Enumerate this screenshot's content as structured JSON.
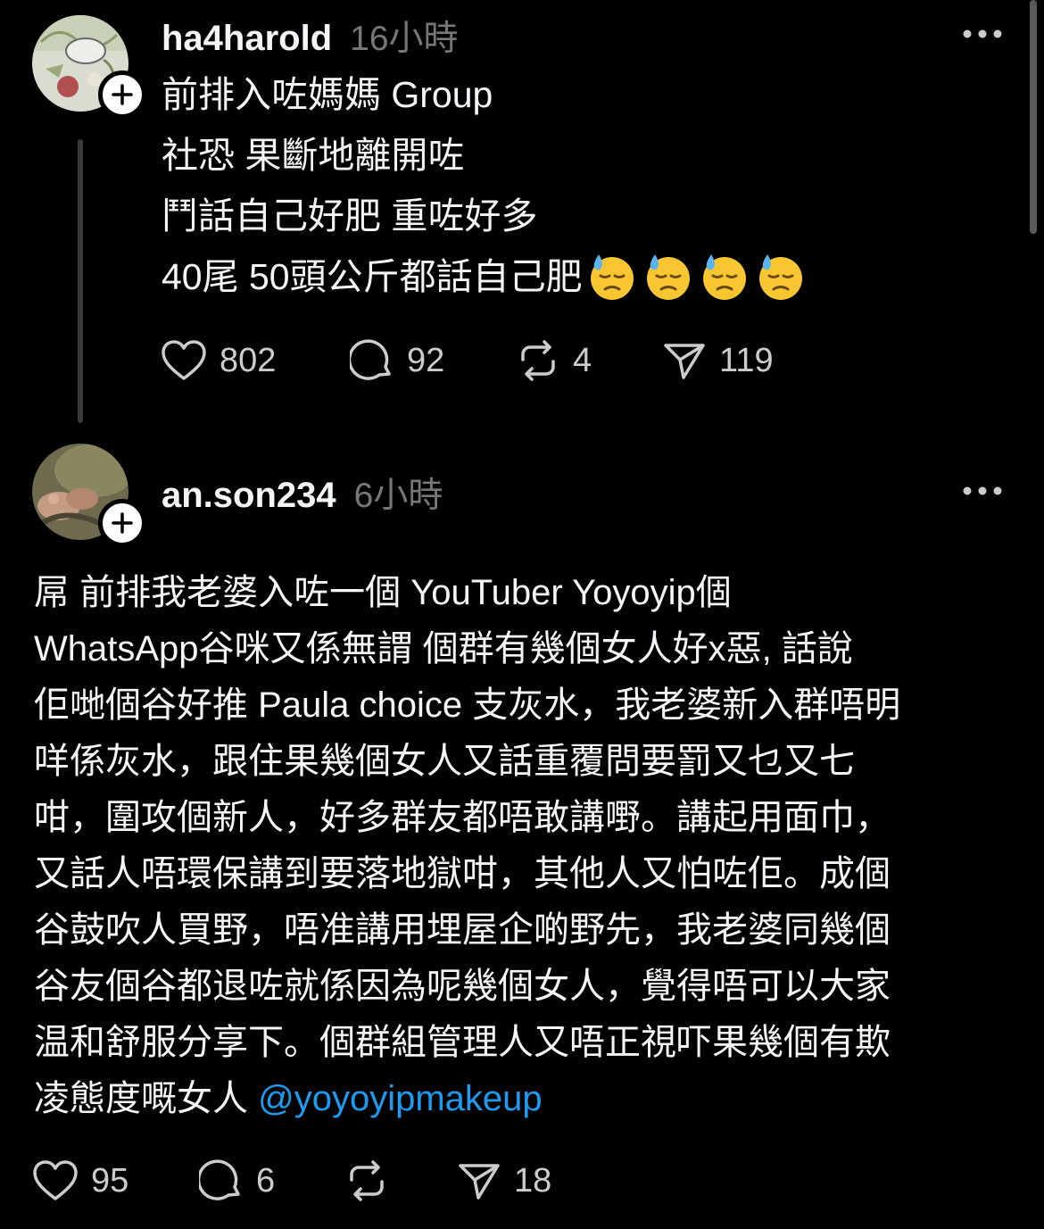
{
  "posts": [
    {
      "username": "ha4harold",
      "timestamp": "16小時",
      "lines": [
        "前排入咗媽媽 Group",
        "社恐 果斷地離開咗",
        "鬥話自己好肥 重咗好多",
        "40尾 50頭公斤都話自己肥"
      ],
      "emoji": "downcast-face-with-sweat",
      "emoji_count": 4,
      "likes": "802",
      "replies": "92",
      "reposts": "4",
      "shares": "119"
    },
    {
      "username": "an.son234",
      "timestamp": "6小時",
      "lines": [
        "屌 前排我老婆入咗一個 YouTuber Yoyoyip個",
        " WhatsApp谷咪又係無謂 個群有幾個女人好x惡, 話說",
        "佢哋個谷好推 Paula choice 支灰水，我老婆新入群唔明",
        "咩係灰水，跟住果幾個女人又話重覆問要罰又乜又七",
        "咁，圍攻個新人，好多群友都唔敢講嘢。講起用面巾，",
        "又話人唔環保講到要落地獄咁，其他人又怕咗佢。成個",
        "谷鼓吹人買野，唔准講用埋屋企啲野先，我老婆同幾個",
        "谷友個谷都退咗就係因為呢幾個女人，覺得唔可以大家",
        "温和舒服分享下。個群組管理人又唔正視吓果幾個有欺"
      ],
      "last_line": "凌態度嘅女人 ",
      "mention": "@yoyoyipmakeup",
      "likes": "95",
      "replies": "6",
      "reposts": "",
      "shares": "18"
    }
  ],
  "colors": {
    "background": "#000000",
    "text": "#f3f5f7",
    "secondary": "#777777",
    "mention": "#1d9bf0",
    "thread_line": "#3a3a3a"
  },
  "icons": [
    "heart-icon",
    "comment-icon",
    "repost-icon",
    "share-icon",
    "more-icon",
    "follow-plus-icon",
    "downcast-sweat-emoji"
  ]
}
